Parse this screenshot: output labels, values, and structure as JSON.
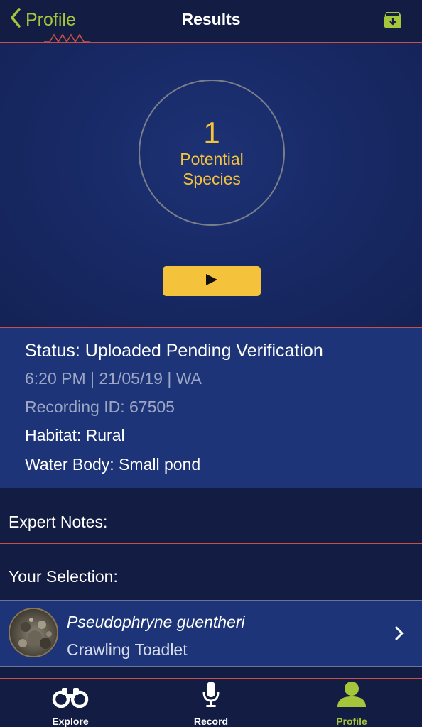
{
  "nav": {
    "back_label": "Profile",
    "title": "Results",
    "back_icon": "chevron-left-icon",
    "action_icon": "archive-download-icon"
  },
  "summary": {
    "count": "1",
    "label_line1": "Potential",
    "label_line2": "Species",
    "play_icon": "play-icon"
  },
  "details": {
    "status": "Status: Uploaded Pending Verification",
    "datetime": "6:20 PM | 21/05/19 | WA",
    "recording_id": "Recording ID: 67505",
    "habitat": "Habitat: Rural",
    "water_body": "Water Body: Small pond"
  },
  "expert_notes": {
    "label": "Expert Notes:"
  },
  "selection": {
    "label": "Your Selection:",
    "species": {
      "scientific_name": "Pseudophryne guentheri",
      "common_name": "Crawling Toadlet"
    }
  },
  "tabs": [
    {
      "label": "Explore",
      "icon": "binoculars-icon",
      "active": false
    },
    {
      "label": "Record",
      "icon": "microphone-icon",
      "active": false
    },
    {
      "label": "Profile",
      "icon": "user-icon",
      "active": true
    }
  ],
  "colors": {
    "accent_green": "#a5c63b",
    "accent_yellow": "#f5c33b",
    "divider_red": "#c9504a",
    "panel_blue": "#1d3578",
    "background_navy": "#131c42"
  }
}
